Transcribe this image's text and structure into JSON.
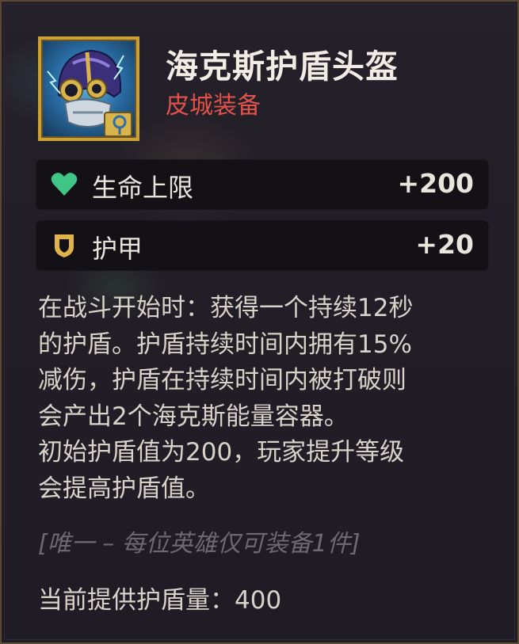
{
  "item": {
    "name": "海克斯护盾头盔",
    "category": "皮城装备",
    "icon": "hextech-helmet-icon"
  },
  "stats": [
    {
      "icon": "heart-icon",
      "label": "生命上限",
      "value": "+200",
      "color": "#3fc586"
    },
    {
      "icon": "armor-shield-icon",
      "label": "护甲",
      "value": "+20",
      "color": "#e0b24a"
    }
  ],
  "description": {
    "lines": [
      "在战斗开始时：获得一个持续12秒",
      "的护盾。护盾持续时间内拥有15%",
      "减伤，护盾在持续时间内被打破则",
      "会产出2个海克斯能量容器。",
      "初始护盾值为200，玩家提升等级",
      "会提高护盾值。"
    ]
  },
  "unique_note": "[唯一 – 每位英雄仅可装备1件]",
  "current_shield": "当前提供护盾量：400",
  "colors": {
    "title": "#f1ece4",
    "category": "#e0524a",
    "frame_gold": "#c9a13a",
    "panel_bg": "#231f28"
  }
}
